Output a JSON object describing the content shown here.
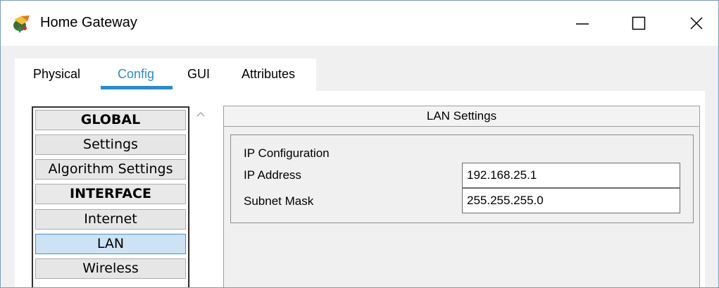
{
  "window": {
    "title": "Home Gateway",
    "minimize_icon": "minimize-icon",
    "maximize_icon": "maximize-icon",
    "close_icon": "close-icon"
  },
  "tabs": [
    {
      "label": "Physical"
    },
    {
      "label": "Config",
      "active": true
    },
    {
      "label": "GUI"
    },
    {
      "label": "Attributes"
    }
  ],
  "sidebar": {
    "items": [
      {
        "label": "GLOBAL",
        "type": "header"
      },
      {
        "label": "Settings"
      },
      {
        "label": "Algorithm Settings"
      },
      {
        "label": "INTERFACE",
        "type": "header"
      },
      {
        "label": "Internet"
      },
      {
        "label": "LAN",
        "selected": true
      },
      {
        "label": "Wireless"
      }
    ]
  },
  "panel": {
    "title": "LAN Settings",
    "group_title": "IP Configuration",
    "fields": [
      {
        "label": "IP Address",
        "value": "192.168.25.1"
      },
      {
        "label": "Subnet Mask",
        "value": "255.255.255.0"
      }
    ]
  },
  "colors": {
    "accent": "#2a8bd1",
    "selected_bg": "#cde3f5"
  }
}
